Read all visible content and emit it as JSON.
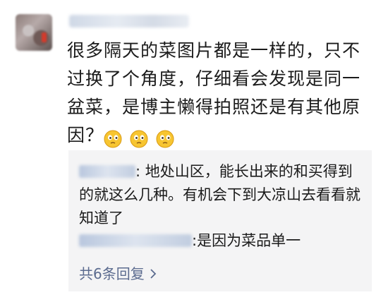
{
  "comment": {
    "author_avatar": "avatar",
    "text": "很多隔天的菜图片都是一样的，只不过换了个角度，仔细看会发现是同一盆菜，是博主懒得拍照还是有其他原因？",
    "emojis": [
      "confused-face-icon",
      "confused-face-icon",
      "confused-face-icon"
    ]
  },
  "replies": [
    {
      "separator": ":",
      "text": "地处山区，能长出来的和买得到的就这么几种。有机会下到大凉山去看看就知道了"
    },
    {
      "separator": ":",
      "text": "是因为菜品单一"
    }
  ],
  "more_replies": {
    "label": "共6条回复"
  },
  "colors": {
    "reply_bg": "#f4f4f5",
    "link": "#5b6b8f",
    "text": "#1b1b1b"
  }
}
